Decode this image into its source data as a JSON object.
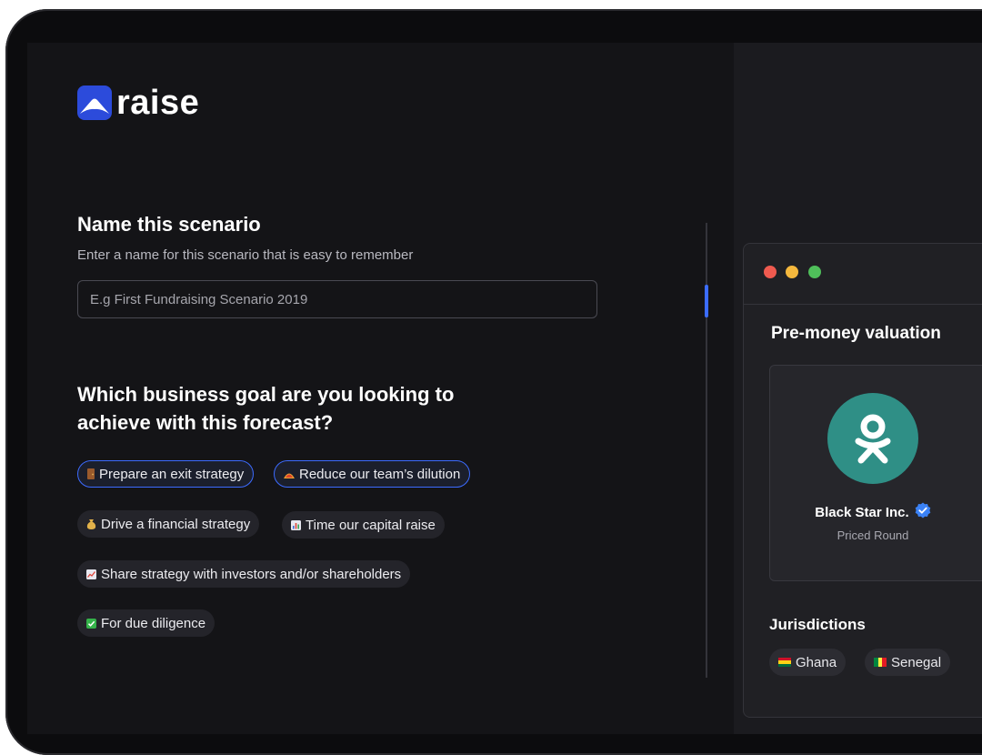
{
  "brand": {
    "name": "raise",
    "accent": "#2c4bdb"
  },
  "scenario": {
    "title": "Name this scenario",
    "subtitle": "Enter a name for this scenario that is easy to remember",
    "input_placeholder": "E.g First Fundraising Scenario 2019",
    "input_value": ""
  },
  "goals": {
    "title": "Which business goal are you looking to achieve with this forecast?",
    "options": [
      {
        "emoji": "🚪",
        "label": "Prepare an exit strategy",
        "selected": true
      },
      {
        "emoji": "🌮",
        "label": "Reduce our team’s dilution",
        "selected": true
      },
      {
        "emoji": "💰",
        "label": "Drive a financial strategy",
        "selected": false
      },
      {
        "emoji": "📊",
        "label": "Time our capital raise",
        "selected": false
      },
      {
        "emoji": "📈",
        "label": "Share strategy with investors and/or shareholders",
        "selected": false
      },
      {
        "emoji": "✅",
        "label": "For due diligence",
        "selected": false
      }
    ]
  },
  "preview": {
    "title": "Pre-money valuation",
    "company": {
      "name": "Black Star Inc.",
      "type": "Priced Round",
      "logo_icon": "odnoklassniki-icon",
      "verified_icon": "verified-badge-icon"
    },
    "jurisdictions_title": "Jurisdictions",
    "jurisdictions": [
      {
        "label": "Ghana"
      },
      {
        "label": "Senegal"
      }
    ]
  }
}
